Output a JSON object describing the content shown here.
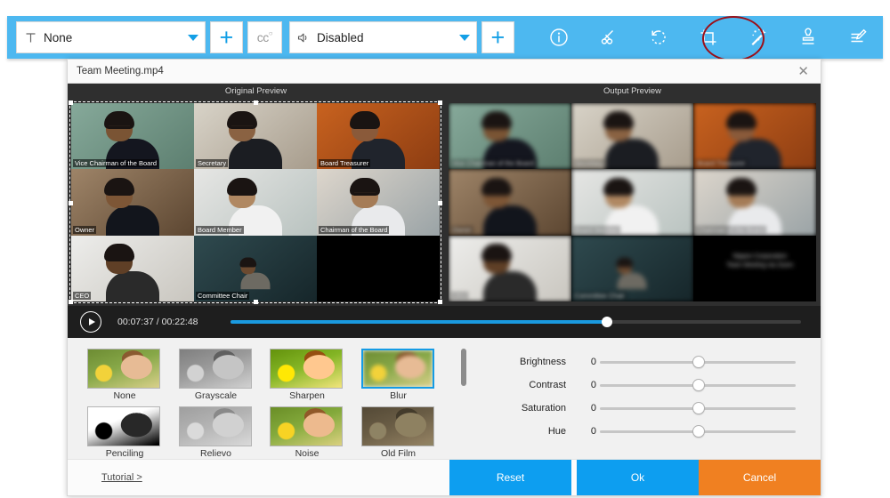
{
  "toolbar": {
    "subtitle": {
      "icon": "text-icon",
      "value": "None"
    },
    "subtitle_add_label": "+",
    "cc_label": "cc",
    "audio": {
      "icon": "speaker-icon",
      "value": "Disabled"
    },
    "audio_add_label": "+",
    "icons": [
      {
        "name": "info-icon"
      },
      {
        "name": "scissors-icon"
      },
      {
        "name": "rotate-icon"
      },
      {
        "name": "crop-icon"
      },
      {
        "name": "magic-wand-icon"
      },
      {
        "name": "watermark-stamp-icon"
      },
      {
        "name": "edit-subtitle-icon"
      }
    ],
    "accent_color": "#4db8f0",
    "annotation_color": "#9c0f18"
  },
  "dialog": {
    "title": "Team Meeting.mp4",
    "close_label": "✕",
    "preview_labels": {
      "original": "Original Preview",
      "output": "Output Preview"
    }
  },
  "video": {
    "participants": [
      "Vice Chairman of the Board",
      "Secretary",
      "Board Treasurer",
      "Owner",
      "Board Member",
      "Chairman of the Board",
      "CEO",
      "Committee Chair"
    ],
    "watermark": [
      "Nippon Corporation",
      "Team Meeting via Zoom"
    ]
  },
  "player": {
    "current_time": "00:07:37",
    "separator": "/",
    "total_time": "00:22:48",
    "progress_percent": 66,
    "play_icon": "play-icon"
  },
  "effects": {
    "selected": "Blur",
    "items": [
      {
        "label": "None",
        "style": "none"
      },
      {
        "label": "Grayscale",
        "style": "gray"
      },
      {
        "label": "Sharpen",
        "style": "sharp"
      },
      {
        "label": "Blur",
        "style": "blur"
      },
      {
        "label": "Penciling",
        "style": "pencil"
      },
      {
        "label": "Relievo",
        "style": "relievo"
      },
      {
        "label": "Noise",
        "style": "noise"
      },
      {
        "label": "Old Film",
        "style": "oldfilm"
      }
    ],
    "selected_border_color": "#159be4"
  },
  "adjustments": [
    {
      "name": "Brightness",
      "value": "0",
      "position_percent": 50
    },
    {
      "name": "Contrast",
      "value": "0",
      "position_percent": 50
    },
    {
      "name": "Saturation",
      "value": "0",
      "position_percent": 50
    },
    {
      "name": "Hue",
      "value": "0",
      "position_percent": 50
    }
  ],
  "footer": {
    "tutorial": "Tutorial >",
    "reset": "Reset",
    "ok": "Ok",
    "cancel": "Cancel",
    "ok_color": "#0d9ef0",
    "cancel_color": "#f08021"
  }
}
